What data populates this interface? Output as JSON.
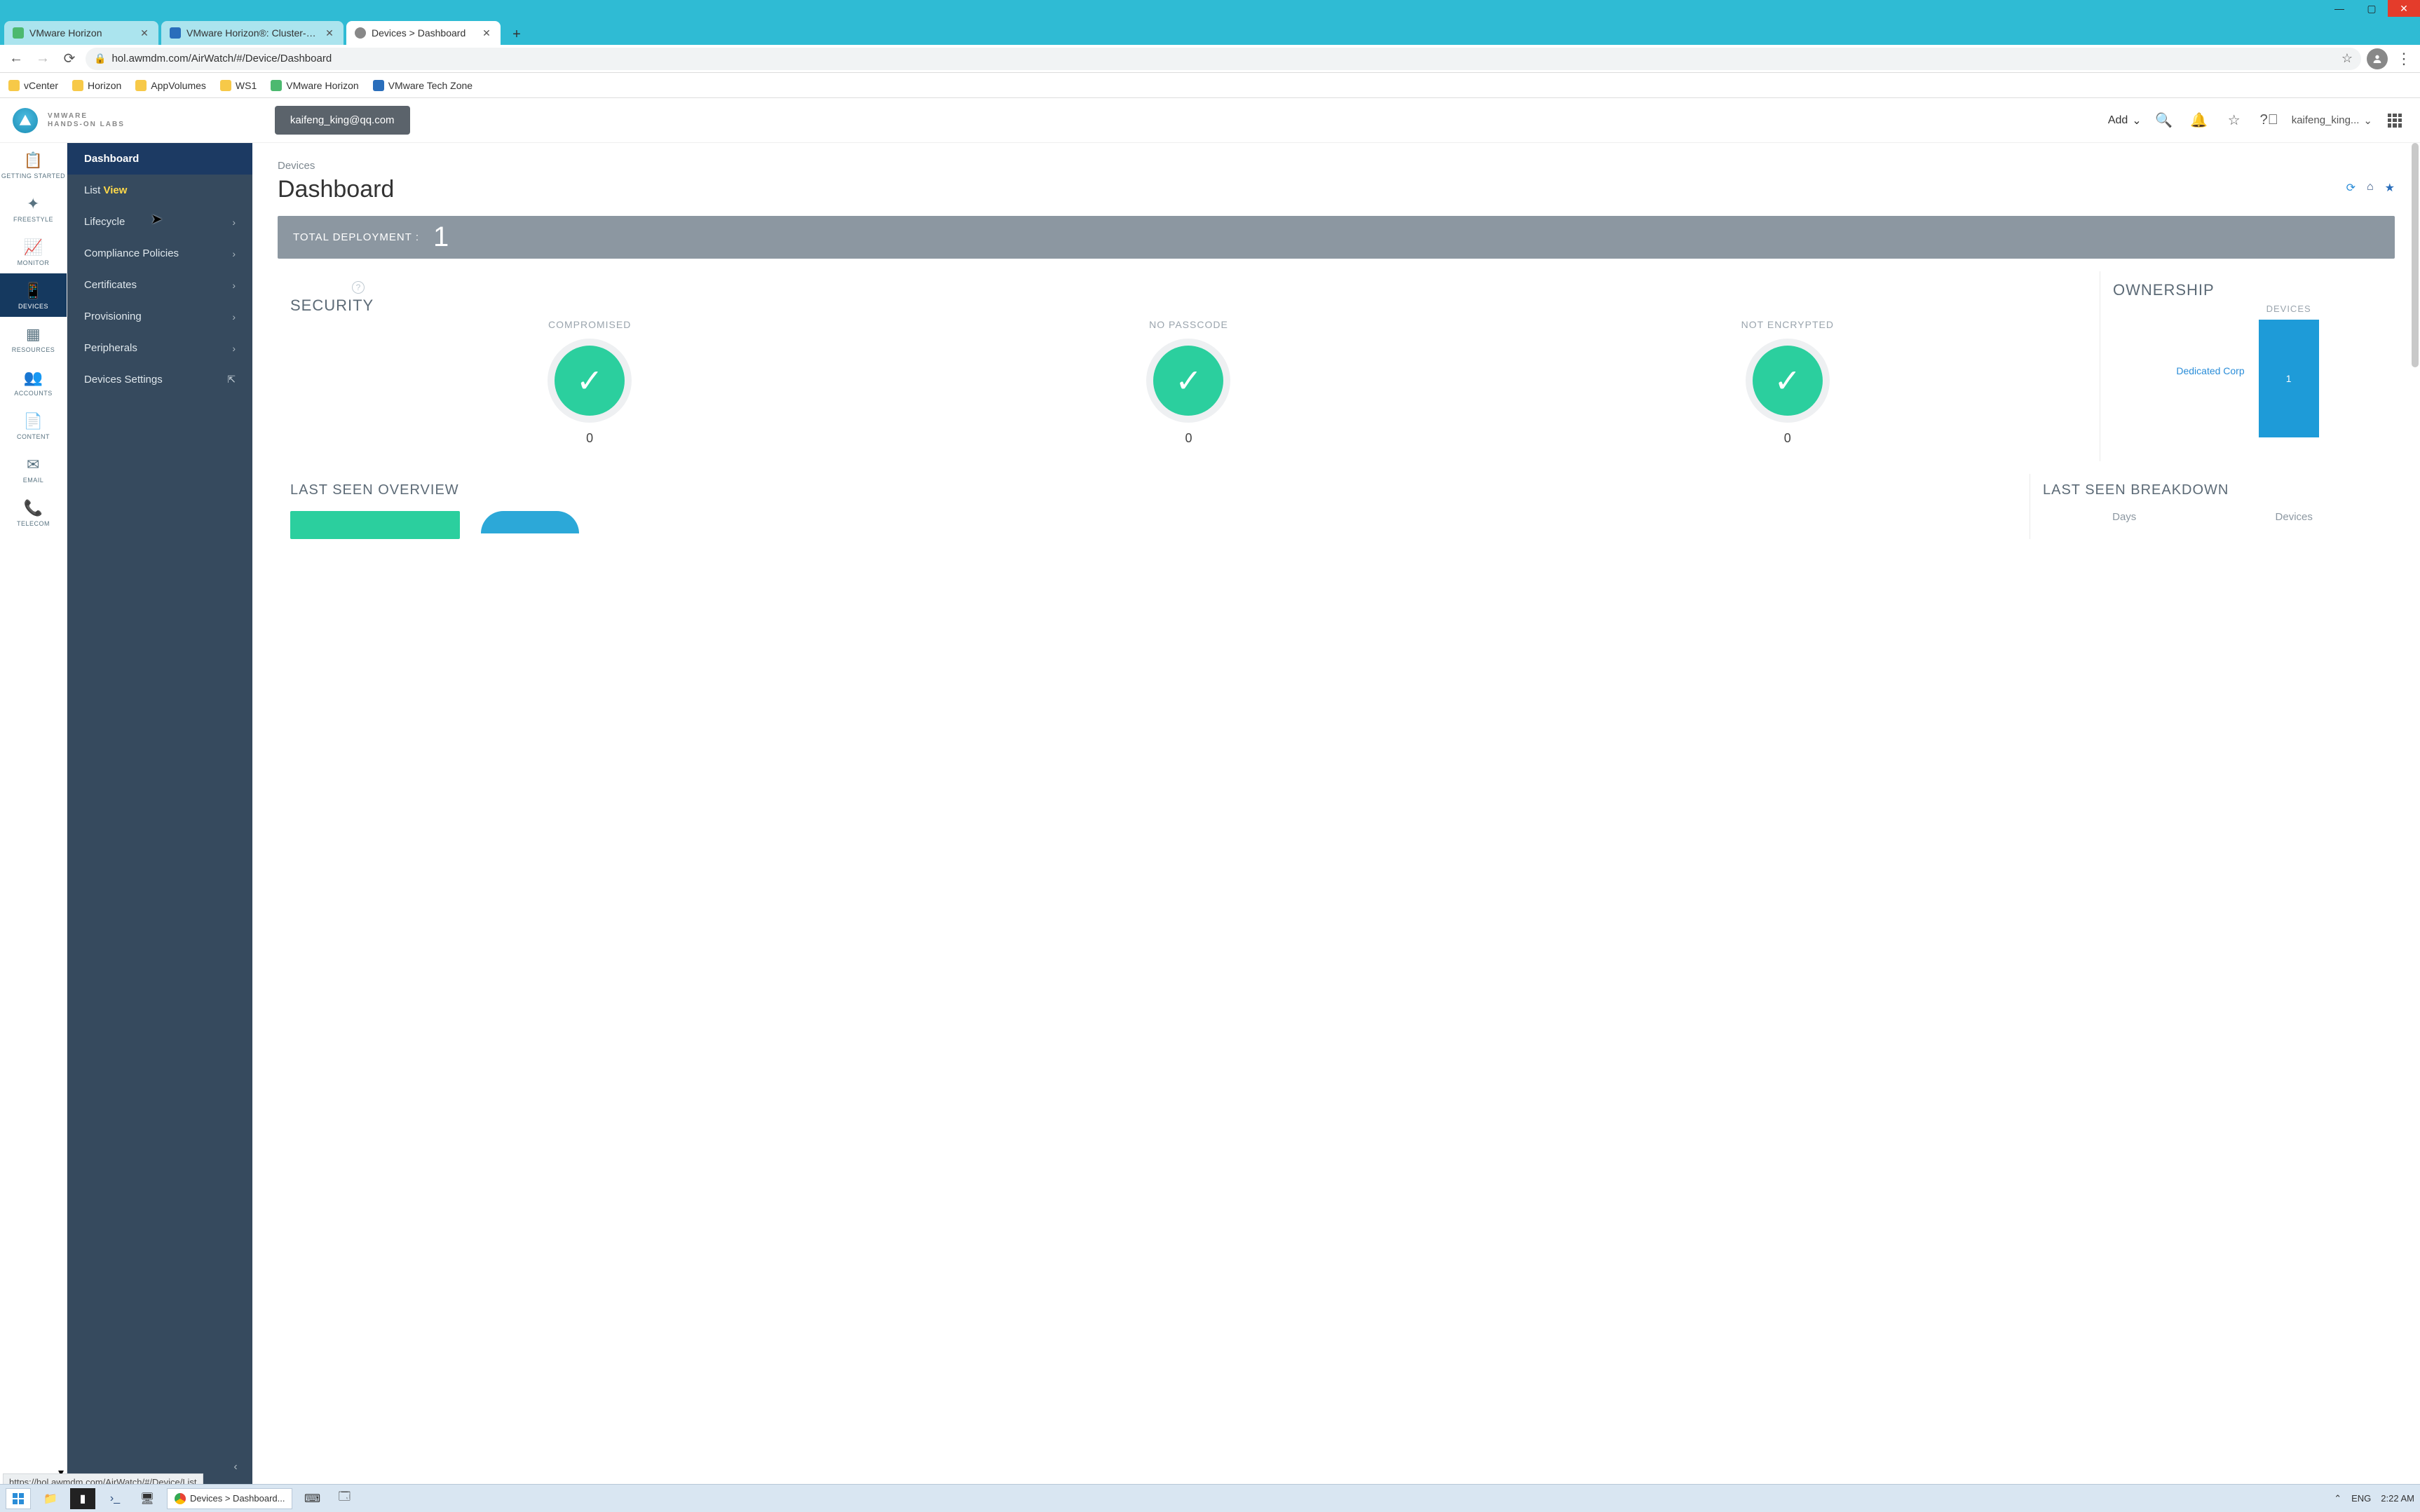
{
  "browser": {
    "tabs": [
      {
        "label": "VMware Horizon",
        "favicon": "#4cb96f"
      },
      {
        "label": "VMware Horizon®: Cluster-HOR",
        "favicon": "#2a6ebb"
      },
      {
        "label": "Devices > Dashboard",
        "favicon": "#888",
        "active": true
      }
    ],
    "url": "hol.awmdm.com/AirWatch/#/Device/Dashboard",
    "bookmarks": [
      {
        "label": "vCenter"
      },
      {
        "label": "Horizon"
      },
      {
        "label": "AppVolumes"
      },
      {
        "label": "WS1"
      },
      {
        "label": "VMware Horizon",
        "cls": "green"
      },
      {
        "label": "VMware Tech Zone",
        "cls": "zone"
      }
    ]
  },
  "header": {
    "brand1": "VMWARE",
    "brand2": "HANDS-ON LABS",
    "account_chip": "kaifeng_king@qq.com",
    "add_label": "Add",
    "user_menu": "kaifeng_king..."
  },
  "rail": {
    "items": [
      {
        "label": "GETTING STARTED",
        "icon": "📋"
      },
      {
        "label": "FREESTYLE",
        "icon": "✦"
      },
      {
        "label": "MONITOR",
        "icon": "📈"
      },
      {
        "label": "DEVICES",
        "icon": "📱",
        "active": true
      },
      {
        "label": "RESOURCES",
        "icon": "▦"
      },
      {
        "label": "ACCOUNTS",
        "icon": "👥"
      },
      {
        "label": "CONTENT",
        "icon": "📄"
      },
      {
        "label": "EMAIL",
        "icon": "✉"
      },
      {
        "label": "TELECOM",
        "icon": "📞"
      }
    ]
  },
  "subnav": {
    "items": [
      {
        "label": "Dashboard",
        "active": true
      },
      {
        "label_first": "List ",
        "label_second": "View",
        "hot": true
      },
      {
        "label": "Lifecycle",
        "expandable": true
      },
      {
        "label": "Compliance Policies",
        "expandable": true
      },
      {
        "label": "Certificates",
        "expandable": true
      },
      {
        "label": "Provisioning",
        "expandable": true
      },
      {
        "label": "Peripherals",
        "expandable": true
      },
      {
        "label": "Devices Settings",
        "external": true
      }
    ]
  },
  "main": {
    "breadcrumb": "Devices",
    "title": "Dashboard",
    "total_label": "TOTAL DEPLOYMENT :",
    "total_value": "1",
    "security": {
      "head": "SECURITY",
      "items": [
        {
          "label": "COMPROMISED",
          "count": "0"
        },
        {
          "label": "NO PASSCODE",
          "count": "0"
        },
        {
          "label": "NOT ENCRYPTED",
          "count": "0"
        }
      ]
    },
    "ownership": {
      "head": "OWNERSHIP",
      "col_head": "DEVICES",
      "row_label": "Dedicated Corp",
      "row_value": "1"
    },
    "last_seen_overview": "LAST SEEN OVERVIEW",
    "last_seen_breakdown": "LAST SEEN BREAKDOWN",
    "bd_col1": "Days",
    "bd_col2": "Devices"
  },
  "status_link": "https://hol.awmdm.com/AirWatch/#/Device/List",
  "taskbar": {
    "task_label": "Devices > Dashboard...",
    "lang": "ENG",
    "clock": "2:22 AM"
  },
  "chart_data": {
    "type": "bar",
    "title": "Ownership — Devices",
    "categories": [
      "Dedicated Corp"
    ],
    "values": [
      1
    ],
    "xlabel": "",
    "ylabel": "Devices",
    "ylim": [
      0,
      1
    ]
  }
}
